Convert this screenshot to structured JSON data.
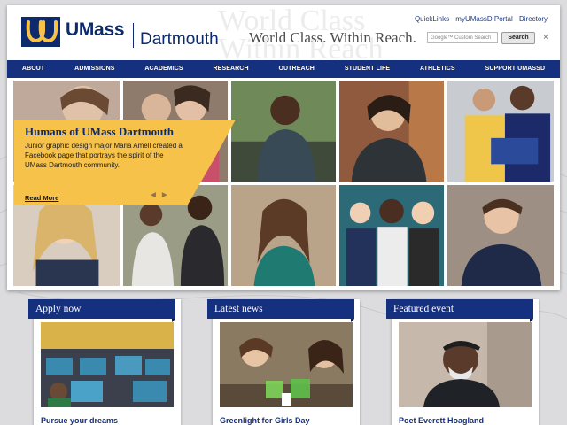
{
  "header": {
    "brand_name": "UMass",
    "campus_name": "Dartmouth",
    "watermark": "World Class\nWithin Reach",
    "tagline": "World Class. Within Reach.",
    "util_links": [
      "QuickLinks",
      "myUMassD Portal",
      "Directory"
    ],
    "search": {
      "placeholder": "Google™ Custom Search",
      "button_label": "Search"
    },
    "close_glyph": "×"
  },
  "nav": {
    "items": [
      "ABOUT",
      "ADMISSIONS",
      "ACADEMICS",
      "RESEARCH",
      "OUTREACH",
      "STUDENT LIFE",
      "ATHLETICS",
      "SUPPORT UMASSD"
    ]
  },
  "feature": {
    "title": "Humans of UMass Dartmouth",
    "body": "Junior graphic design major Maria Amell created a Facebook page that portrays the spirit of the UMass Dartmouth community.",
    "link_label": "Read More",
    "arrows": "◄►"
  },
  "cards": [
    {
      "heading": "Apply now",
      "caption": "Pursue your dreams"
    },
    {
      "heading": "Latest news",
      "caption": "Greenlight for Girls Day"
    },
    {
      "heading": "Featured event",
      "caption": "Poet Everett Hoagland"
    }
  ],
  "colors": {
    "brand_navy": "#0d2a6c",
    "nav_blue": "#15307f",
    "callout_gold": "#f7c24a",
    "page_bg": "#dcdcde"
  },
  "icons": [
    "umass-logo-icon",
    "close-icon",
    "prev-arrow-icon",
    "next-arrow-icon"
  ]
}
